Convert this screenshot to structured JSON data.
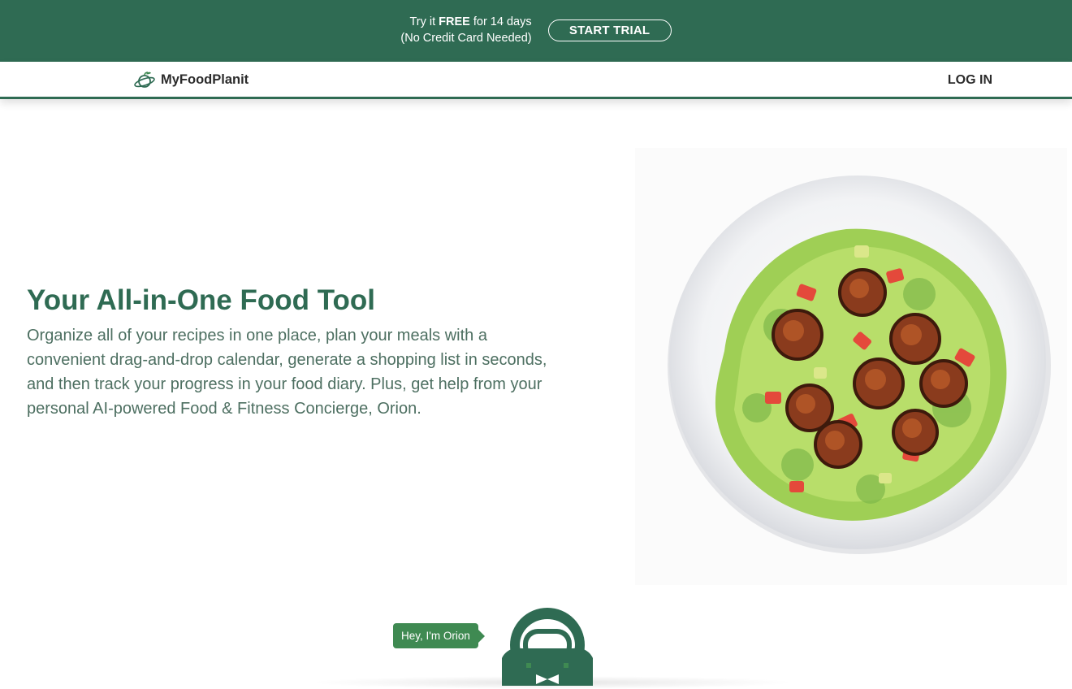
{
  "promo": {
    "line1_prefix": "Try it ",
    "line1_bold": "FREE",
    "line1_suffix": " for 14 days",
    "line2": "(No Credit Card Needed)",
    "cta": "START TRIAL"
  },
  "nav": {
    "brand": "MyFoodPlanit",
    "login": "LOG IN"
  },
  "hero": {
    "title": "Your All-in-One Food Tool",
    "description": "Organize all of your recipes in one place, plan your meals with a convenient drag-and-drop calendar, generate a shopping list in seconds, and then track your progress in your food diary. Plus, get help from your personal AI-powered Food & Fitness Concierge, Orion."
  },
  "mascot": {
    "greeting": "Hey, I'm Orion"
  },
  "colors": {
    "brand_green": "#2f6b53",
    "bubble_green": "#3f8a52"
  },
  "icons": {
    "logo": "planet-logo-icon",
    "mascot": "astronaut-mascot-icon"
  }
}
